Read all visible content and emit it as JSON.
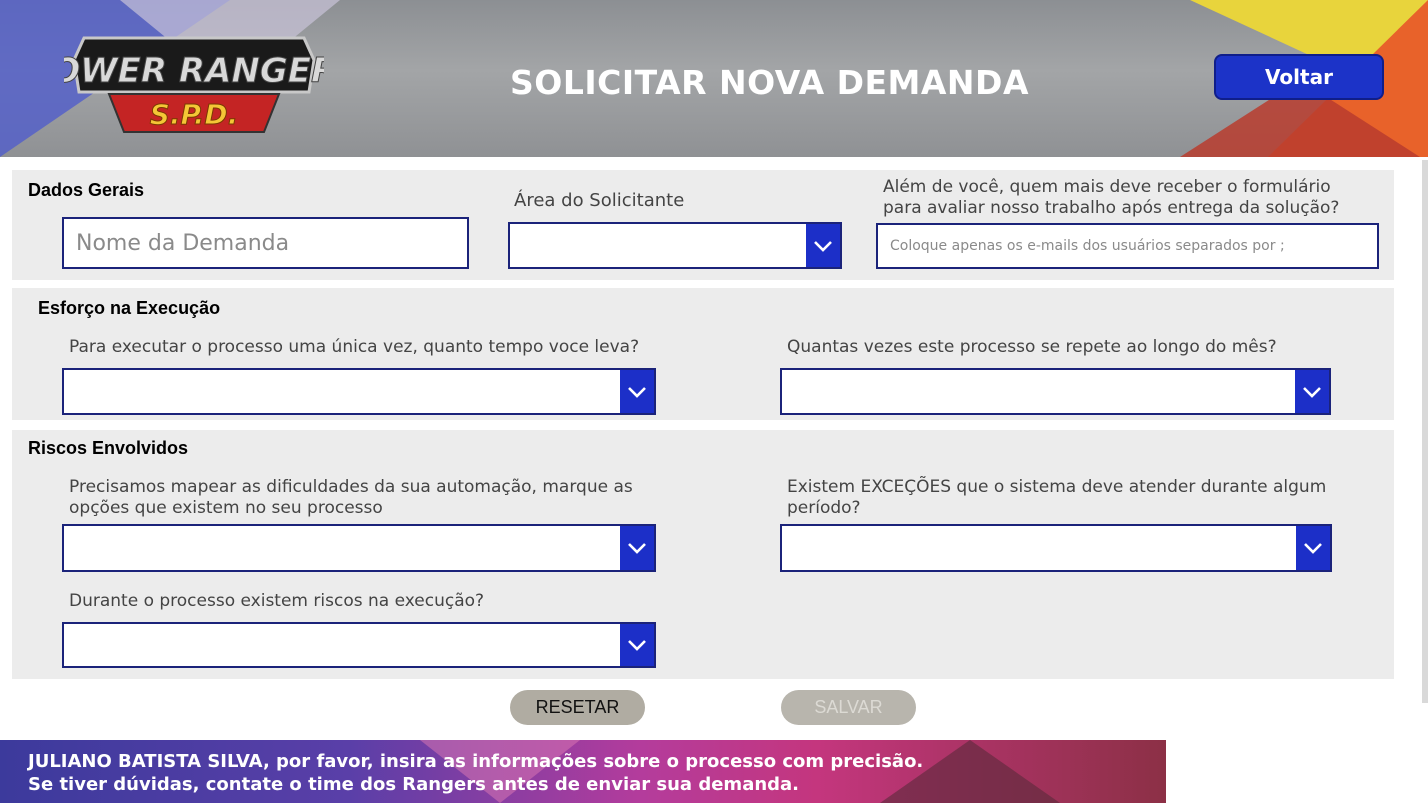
{
  "header": {
    "title": "SOLICITAR NOVA DEMANDA",
    "back_label": "Voltar",
    "logo_text_top": "POWER RANGERS",
    "logo_text_bottom": "S.P.D."
  },
  "sections": {
    "general": {
      "title": "Dados Gerais",
      "demand_name_placeholder": "Nome da Demanda",
      "area_label": "Área do Solicitante",
      "area_value": "",
      "recipients_label": "Além de você, quem mais deve receber o formulário para avaliar nosso trabalho após entrega da solução?",
      "recipients_placeholder": "Coloque apenas os e-mails dos usuários separados por ;"
    },
    "effort": {
      "title": "Esforço na Execução",
      "time_label": "Para executar o processo uma única vez, quanto tempo voce leva?",
      "time_value": "",
      "frequency_label": "Quantas vezes este processo se repete ao longo do mês?",
      "frequency_value": ""
    },
    "risks": {
      "title": "Riscos Envolvidos",
      "difficulties_label": "Precisamos mapear as dificuldades da sua automação, marque as opções que existem no seu processo",
      "difficulties_value": "",
      "exceptions_label": "Existem EXCEÇÕES que o sistema deve atender durante algum período?",
      "exceptions_value": "",
      "execution_risk_label": "Durante o processo existem riscos na execução?",
      "execution_risk_value": ""
    }
  },
  "actions": {
    "reset_label": "RESETAR",
    "save_label": "SALVAR"
  },
  "footer": {
    "line1": "JULIANO BATISTA SILVA, por favor, insira as informações sobre o processo com precisão.",
    "line2": "Se tiver dúvidas, contate o time dos Rangers antes de enviar sua demanda."
  },
  "colors": {
    "accent_blue": "#1c2fc8",
    "border_navy": "#1b237a",
    "section_bg": "#ececec",
    "button_gray": "#b0aca2"
  },
  "icons": [
    "chevron-down-icon",
    "power-rangers-logo"
  ]
}
